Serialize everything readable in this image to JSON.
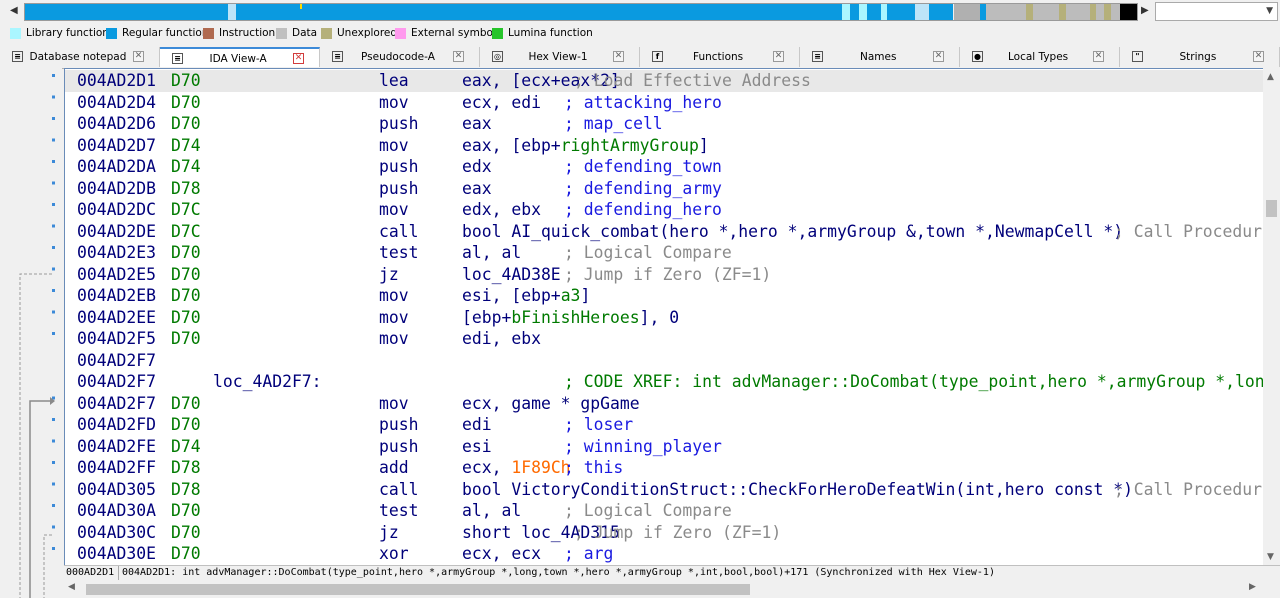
{
  "nav": {
    "segments": [
      {
        "start": 0,
        "end": 0.17,
        "color": "#0a9ae0"
      },
      {
        "start": 0.17,
        "end": 0.183,
        "color": "#0a9ae0"
      },
      {
        "start": 0.183,
        "end": 0.19,
        "color": "#bde4f8"
      },
      {
        "start": 0.19,
        "end": 0.735,
        "color": "#0a9ae0"
      },
      {
        "start": 0.735,
        "end": 0.742,
        "color": "#aaf6ff"
      },
      {
        "start": 0.742,
        "end": 0.75,
        "color": "#0a9ae0"
      },
      {
        "start": 0.75,
        "end": 0.757,
        "color": "#aaf6ff"
      },
      {
        "start": 0.757,
        "end": 0.77,
        "color": "#0a9ae0"
      },
      {
        "start": 0.77,
        "end": 0.775,
        "color": "#aaf6ff"
      },
      {
        "start": 0.775,
        "end": 0.8,
        "color": "#0a9ae0"
      },
      {
        "start": 0.8,
        "end": 0.813,
        "color": "#bde4f8"
      },
      {
        "start": 0.813,
        "end": 0.835,
        "color": "#0a9ae0"
      },
      {
        "start": 0.835,
        "end": 0.858,
        "color": "#b0b0b0"
      },
      {
        "start": 0.858,
        "end": 0.864,
        "color": "#0a9ae0"
      },
      {
        "start": 0.864,
        "end": 0.9,
        "color": "#bcbcbc"
      },
      {
        "start": 0.9,
        "end": 0.906,
        "color": "#b5b07a"
      },
      {
        "start": 0.906,
        "end": 0.93,
        "color": "#bcbcbc"
      },
      {
        "start": 0.93,
        "end": 0.936,
        "color": "#b5b07a"
      },
      {
        "start": 0.936,
        "end": 0.958,
        "color": "#bcbcbc"
      },
      {
        "start": 0.958,
        "end": 0.963,
        "color": "#b5b07a"
      },
      {
        "start": 0.963,
        "end": 0.97,
        "color": "#bcbcbc"
      },
      {
        "start": 0.97,
        "end": 0.976,
        "color": "#b5b07a"
      },
      {
        "start": 0.976,
        "end": 0.985,
        "color": "#bcbcbc"
      },
      {
        "start": 0.985,
        "end": 1.0,
        "color": "#000000"
      }
    ],
    "left_arrow": "◀",
    "right_arrow": "▶",
    "combo_arrow": "▼"
  },
  "legend": [
    {
      "label": "Library function",
      "color": "#aaf6ff"
    },
    {
      "label": "Regular function",
      "color": "#0a9ae0"
    },
    {
      "label": "Instruction",
      "color": "#b06a50"
    },
    {
      "label": "Data",
      "color": "#c0c0c0"
    },
    {
      "label": "Unexplored",
      "color": "#b5b07a"
    },
    {
      "label": "External symbol",
      "color": "#ff9aee"
    },
    {
      "label": "Lumina function",
      "color": "#26c42a"
    }
  ],
  "tabs": [
    {
      "label": "Database notepad",
      "icon": "notepad-icon",
      "glyph": "≡",
      "active": false
    },
    {
      "label": "IDA View-A",
      "icon": "listing-icon",
      "glyph": "≡",
      "active": true
    },
    {
      "label": "Pseudocode-A",
      "icon": "pseudocode-icon",
      "glyph": "≡",
      "active": false
    },
    {
      "label": "Hex View-1",
      "icon": "hex-icon",
      "glyph": "◎",
      "active": false
    },
    {
      "label": "Functions",
      "icon": "functions-icon",
      "glyph": "f",
      "active": false
    },
    {
      "label": "Names",
      "icon": "names-icon",
      "glyph": "≡",
      "active": false
    },
    {
      "label": "Local Types",
      "icon": "local-types-icon",
      "glyph": "●",
      "active": false
    },
    {
      "label": "Strings",
      "icon": "strings-icon",
      "glyph": "\"",
      "active": false
    }
  ],
  "close_glyph": "✕",
  "listing": [
    {
      "addr": "004AD2D1",
      "sp": "D70",
      "mn": "lea",
      "op": [
        [
          "eax, [ecx+eax*2]",
          "plain"
        ]
      ],
      "cmt": "; Load Effective Address",
      "cmt_kind": "grey",
      "cmt_col": 573,
      "current": true
    },
    {
      "addr": "004AD2D4",
      "sp": "D70",
      "mn": "mov",
      "op": [
        [
          "ecx, edi",
          "plain"
        ]
      ],
      "cmt": "; attacking_hero",
      "cmt_kind": "blue",
      "cmt_col": 563
    },
    {
      "addr": "004AD2D6",
      "sp": "D70",
      "mn": "push",
      "op": [
        [
          "eax",
          "plain"
        ]
      ],
      "cmt": "; map_cell",
      "cmt_kind": "blue",
      "cmt_col": 563
    },
    {
      "addr": "004AD2D7",
      "sp": "D74",
      "mn": "mov",
      "op": [
        [
          "eax, [ebp+",
          "plain"
        ],
        [
          "rightArmyGroup",
          "var"
        ],
        [
          "]",
          "plain"
        ]
      ]
    },
    {
      "addr": "004AD2DA",
      "sp": "D74",
      "mn": "push",
      "op": [
        [
          "edx",
          "plain"
        ]
      ],
      "cmt": "; defending_town",
      "cmt_kind": "blue",
      "cmt_col": 563
    },
    {
      "addr": "004AD2DB",
      "sp": "D78",
      "mn": "push",
      "op": [
        [
          "eax",
          "plain"
        ]
      ],
      "cmt": "; defending_army",
      "cmt_kind": "blue",
      "cmt_col": 563
    },
    {
      "addr": "004AD2DC",
      "sp": "D7C",
      "mn": "mov",
      "op": [
        [
          "edx, ebx",
          "plain"
        ]
      ],
      "cmt": "; defending_hero",
      "cmt_kind": "blue",
      "cmt_col": 563
    },
    {
      "addr": "004AD2DE",
      "sp": "D7C",
      "mn": "call",
      "op": [
        [
          "bool AI_quick_combat(hero *,hero *,armyGroup &,town *,NewmapCell *)",
          "plain"
        ]
      ],
      "cmt": "; Call Procedure",
      "cmt_kind": "grey",
      "cmt_col": 1113
    },
    {
      "addr": "004AD2E3",
      "sp": "D70",
      "mn": "test",
      "op": [
        [
          "al, al",
          "plain"
        ]
      ],
      "cmt": "; Logical Compare",
      "cmt_kind": "grey",
      "cmt_col": 563
    },
    {
      "addr": "004AD2E5",
      "sp": "D70",
      "mn": "jz",
      "op": [
        [
          "loc_4AD38E",
          "plain"
        ]
      ],
      "cmt": "; Jump if Zero (ZF=1)",
      "cmt_kind": "grey",
      "cmt_col": 563
    },
    {
      "addr": "004AD2EB",
      "sp": "D70",
      "mn": "mov",
      "op": [
        [
          "esi, [ebp+",
          "plain"
        ],
        [
          "a3",
          "var"
        ],
        [
          "]",
          "plain"
        ]
      ]
    },
    {
      "addr": "004AD2EE",
      "sp": "D70",
      "mn": "mov",
      "op": [
        [
          "[ebp+",
          "plain"
        ],
        [
          "bFinishHeroes",
          "var"
        ],
        [
          "], 0",
          "plain"
        ]
      ]
    },
    {
      "addr": "004AD2F5",
      "sp": "D70",
      "mn": "mov",
      "op": [
        [
          "edi, ebx",
          "plain"
        ]
      ]
    },
    {
      "addr": "004AD2F7"
    },
    {
      "addr": "004AD2F7",
      "label": "loc_4AD2F7:",
      "cmt": "; CODE XREF: int advManager::DoCombat(type_point,hero *,armyGroup *,long,town *,hero *,armyGroup *,int,bool,bool)",
      "cmt_kind": "green",
      "cmt_col": 563
    },
    {
      "addr": "004AD2F7",
      "sp": "D70",
      "mn": "mov",
      "op": [
        [
          "ecx, ",
          "plain"
        ],
        [
          "game * gpGame",
          "plain"
        ]
      ]
    },
    {
      "addr": "004AD2FD",
      "sp": "D70",
      "mn": "push",
      "op": [
        [
          "edi",
          "plain"
        ]
      ],
      "cmt": "; loser",
      "cmt_kind": "blue",
      "cmt_col": 563
    },
    {
      "addr": "004AD2FE",
      "sp": "D74",
      "mn": "push",
      "op": [
        [
          "esi",
          "plain"
        ]
      ],
      "cmt": "; winning_player",
      "cmt_kind": "blue",
      "cmt_col": 563
    },
    {
      "addr": "004AD2FF",
      "sp": "D78",
      "mn": "add",
      "op": [
        [
          "ecx, ",
          "plain"
        ],
        [
          "1F89Ch",
          "num"
        ]
      ],
      "cmt": "; this",
      "cmt_kind": "blue",
      "cmt_col": 563
    },
    {
      "addr": "004AD305",
      "sp": "D78",
      "mn": "call",
      "op": [
        [
          "bool VictoryConditionStruct::CheckForHeroDefeatWin(int,hero const *)",
          "plain"
        ]
      ],
      "cmt": "; Call Procedure",
      "cmt_kind": "grey",
      "cmt_col": 1113
    },
    {
      "addr": "004AD30A",
      "sp": "D70",
      "mn": "test",
      "op": [
        [
          "al, al",
          "plain"
        ]
      ],
      "cmt": "; Logical Compare",
      "cmt_kind": "grey",
      "cmt_col": 563
    },
    {
      "addr": "004AD30C",
      "sp": "D70",
      "mn": "jz",
      "op": [
        [
          "short loc_4AD315",
          "plain"
        ]
      ],
      "cmt": "; Jump if Zero (ZF=1)",
      "cmt_kind": "grey",
      "cmt_col": 573
    },
    {
      "addr": "004AD30E",
      "sp": "D70",
      "mn": "xor",
      "op": [
        [
          "ecx, ecx",
          "plain"
        ]
      ],
      "cmt": "; arg",
      "cmt_kind": "blue",
      "cmt_col": 563
    }
  ],
  "status": {
    "addr": "000AD2D1",
    "text": "004AD2D1: int advManager::DoCombat(type_point,hero *,armyGroup *,long,town *,hero *,armyGroup *,int,bool,bool)+171  (Synchronized with Hex View-1)"
  },
  "scroll": {
    "up": "▲",
    "down": "▼",
    "left": "◀",
    "right": "▶"
  }
}
